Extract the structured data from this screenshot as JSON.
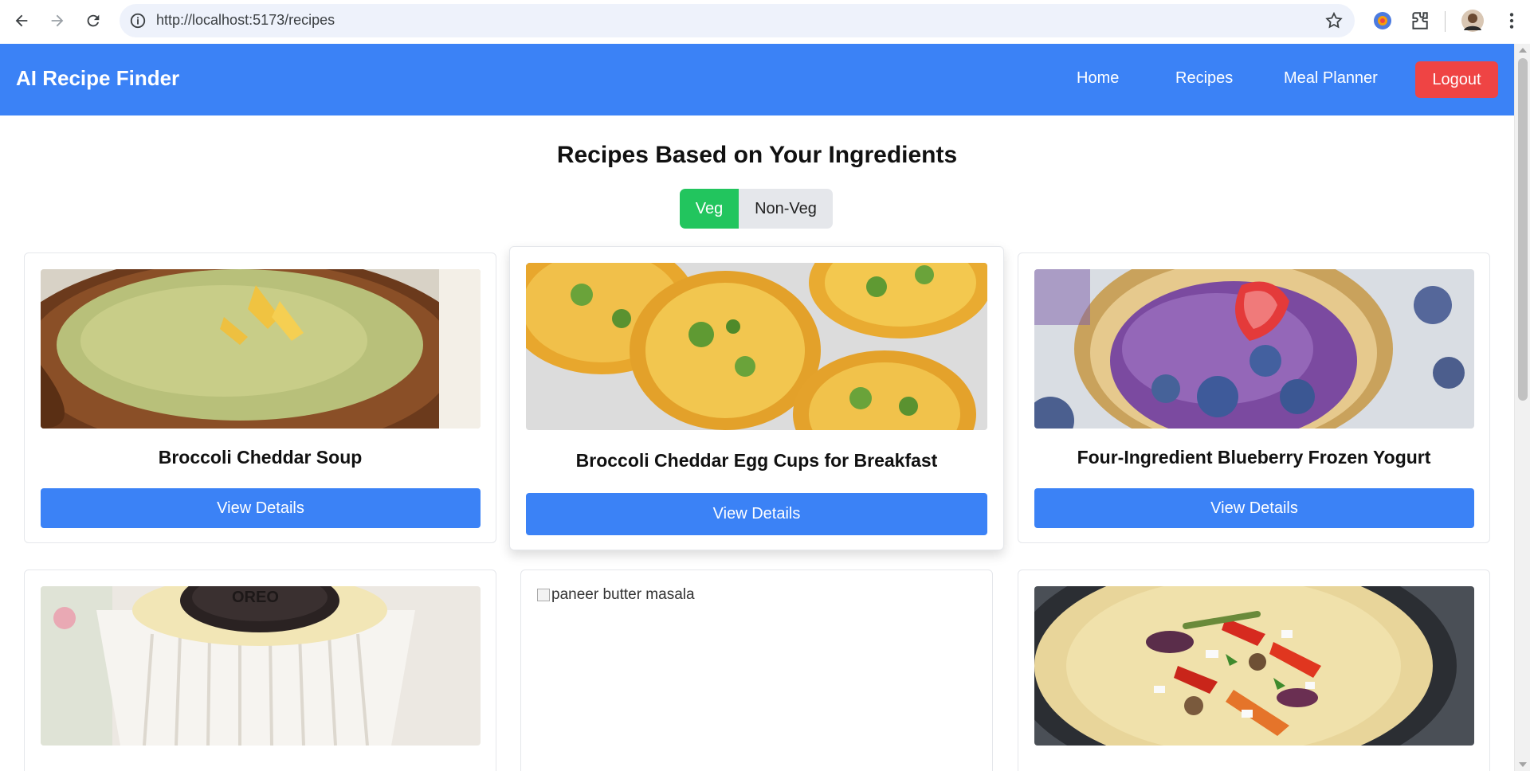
{
  "browser": {
    "url": "http://localhost:5173/recipes",
    "icons": [
      "back-icon",
      "forward-icon",
      "reload-icon",
      "site-info-icon",
      "bookmark-star-icon",
      "extension-icon",
      "puzzle-icon",
      "profile-avatar",
      "kebab-menu-icon"
    ]
  },
  "header": {
    "brand": "AI Recipe Finder",
    "nav": [
      "Home",
      "Recipes",
      "Meal Planner"
    ],
    "logout": "Logout",
    "colors": {
      "header_bg": "#3b82f6",
      "logout_bg": "#ef4444"
    }
  },
  "main": {
    "title": "Recipes Based on Your Ingredients",
    "filter": {
      "options": [
        "Veg",
        "Non-Veg"
      ],
      "selected": "Veg",
      "selected_color": "#22c55e"
    },
    "recipes": [
      {
        "title": "Broccoli Cheddar Soup",
        "button": "View Details",
        "image": "broccoli-cheddar-soup-photo"
      },
      {
        "title": "Broccoli Cheddar Egg Cups for Breakfast",
        "button": "View Details",
        "image": "egg-cups-photo"
      },
      {
        "title": "Four-Ingredient Blueberry Frozen Yogurt",
        "button": "View Details",
        "image": "blueberry-frozen-yogurt-photo"
      },
      {
        "title": "",
        "button": "",
        "image": "oreo-mini-cheesecake-photo"
      },
      {
        "title": "",
        "button": "",
        "image_alt": "paneer butter masala"
      },
      {
        "title": "",
        "button": "",
        "image": "veggie-frittata-photo"
      }
    ]
  }
}
